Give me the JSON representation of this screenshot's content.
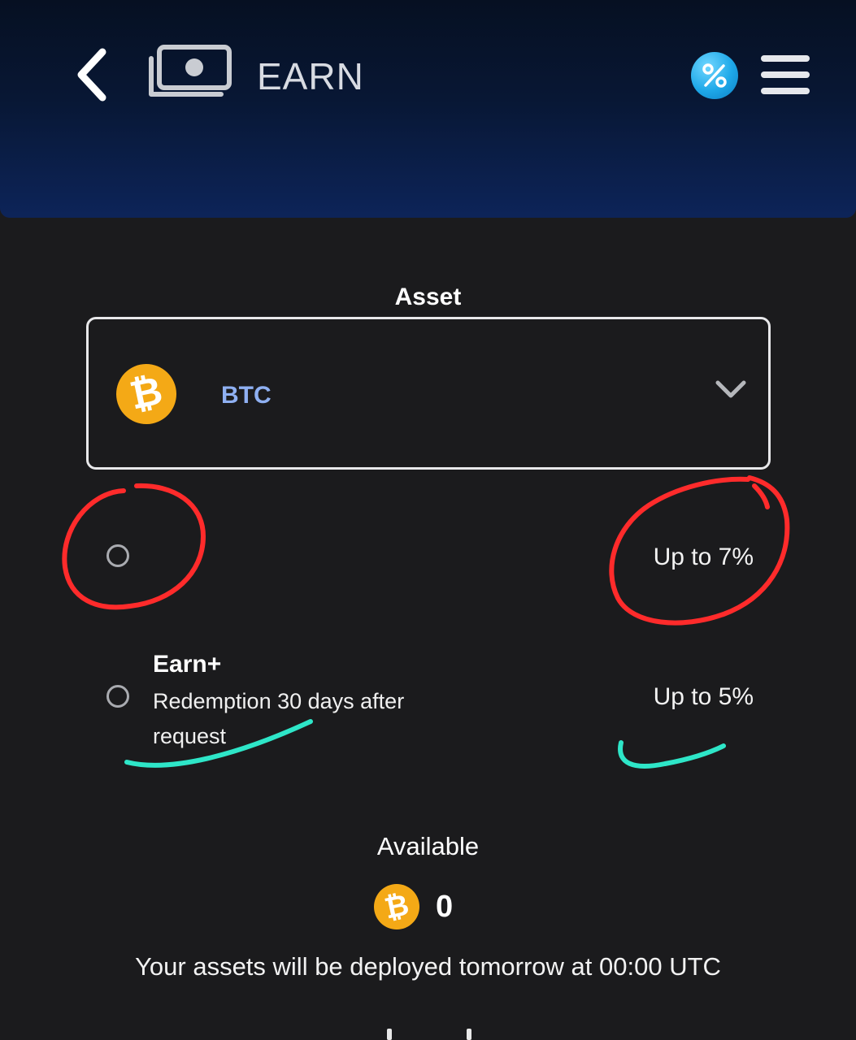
{
  "header": {
    "title": "EARN",
    "back_icon": "chevron-left-icon",
    "earn_icon": "cash-stack-icon",
    "promo_icon": "percent-icon",
    "menu_icon": "hamburger-menu-icon"
  },
  "asset": {
    "label": "Asset",
    "selected": "BTC",
    "coin_glyph": "₿"
  },
  "options": [
    {
      "title": "",
      "rate": "Up to 7%"
    },
    {
      "title": "Earn+",
      "description": "Redemption 30 days after request",
      "rate": "Up to 5%"
    }
  ],
  "available": {
    "label": "Available",
    "coin_glyph": "₿",
    "value": "0",
    "note": "Your assets will be deployed tomorrow at 00:00 UTC"
  },
  "colors": {
    "accent": "#8fb0f2",
    "bitcoin": "#f4a916",
    "annotation_red": "#ff2b2b",
    "annotation_teal": "#2ee6c8"
  }
}
